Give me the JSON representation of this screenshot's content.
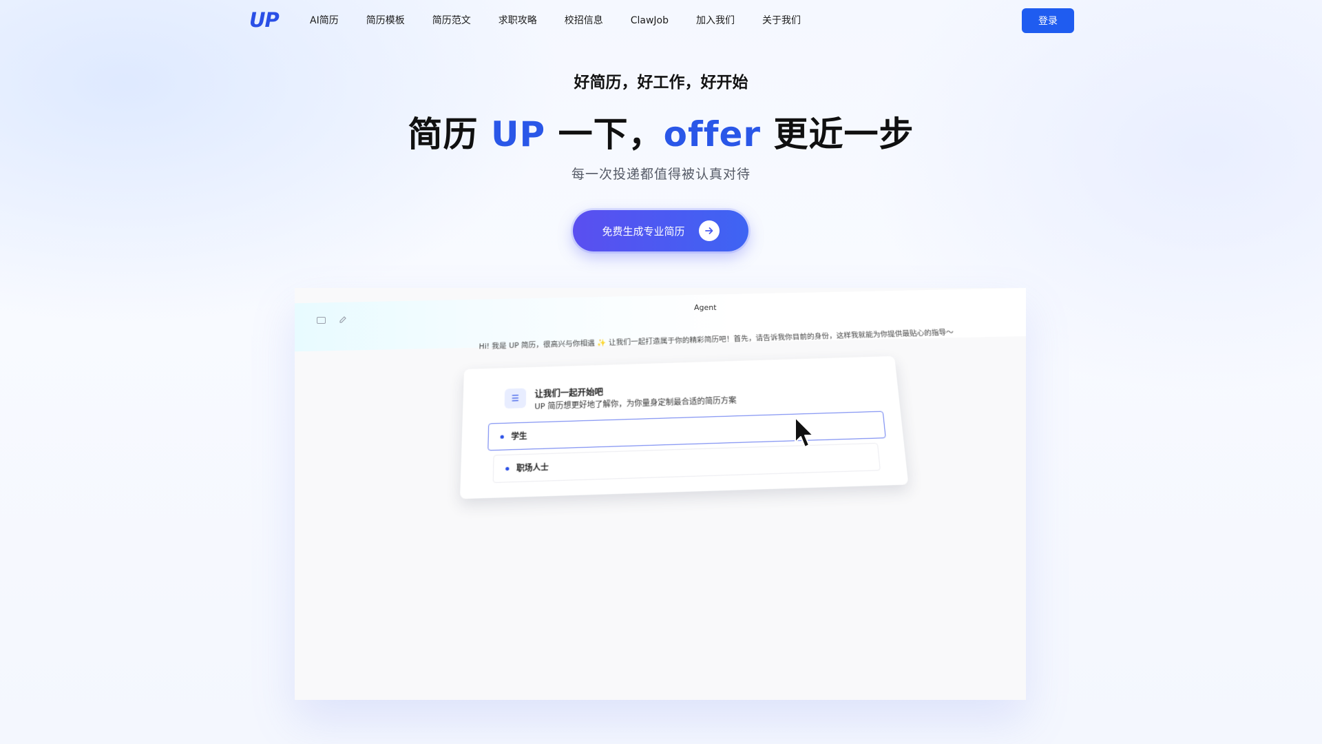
{
  "nav": {
    "logo": "UP",
    "items": [
      "AI简历",
      "简历模板",
      "简历范文",
      "求职攻略",
      "校招信息",
      "ClawJob",
      "加入我们",
      "关于我们"
    ],
    "login_label": "登录"
  },
  "hero": {
    "tagline": "好简历，好工作，好开始",
    "title_part1": "简历 ",
    "title_accent1": "UP",
    "title_part2": " 一下，",
    "title_accent2": "offer",
    "title_part3": " 更近一步",
    "subtitle": "每一次投递都值得被认真对待",
    "cta_label": "免费生成专业简历"
  },
  "preview": {
    "window_title": "Agent",
    "greeting": "Hi! 我是 UP 简历，很高兴与你相遇 ✨ 让我们一起打造属于你的精彩简历吧！首先，请告诉我你目前的身份，这样我就能为你提供最贴心的指导～",
    "card_title": "让我们一起开始吧",
    "card_desc": "UP 简历想更好地了解你，为你量身定制最合适的简历方案",
    "options": [
      "学生",
      "职场人士"
    ]
  },
  "colors": {
    "accent": "#2a57e8",
    "login_bg": "#1f5cf0",
    "cta_start": "#5a4ff0",
    "cta_end": "#3e64f3"
  }
}
